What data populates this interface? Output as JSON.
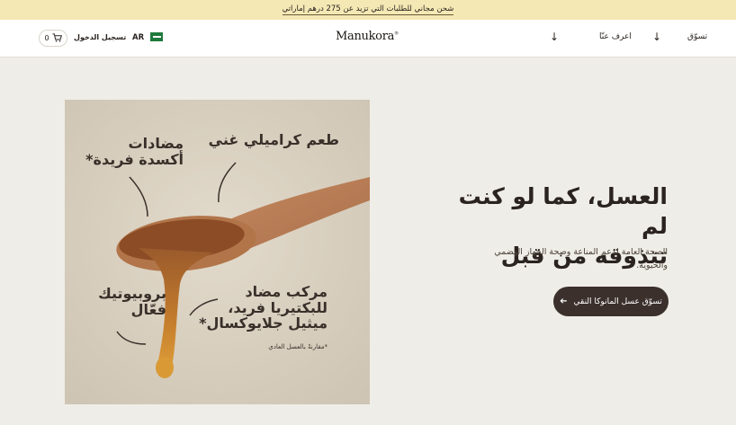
{
  "announcement": "شحن مجاني للطلبات التي تزيد عن 275 درهم إماراتي",
  "header": {
    "cart_count": "0",
    "login_label": "تسجيل الدخول",
    "language": "AR",
    "brand": "Manukora",
    "brand_mark": "®",
    "nav": {
      "shop_label": "تسوّق",
      "about_label": "اعرف عنّا"
    }
  },
  "image_panel": {
    "labels": {
      "caramel": "طعم كراميلي غني",
      "antioxidants_line1": "مضادات",
      "antioxidants_line2": "أكسدة فريدة*",
      "probiotic_line1": "بروبيوتيك",
      "probiotic_line2": "فعّال",
      "antibacterial_line1": "مركب مضاد",
      "antibacterial_line2": "للبكتيريا فريد،",
      "antibacterial_line3": "ميثيل جلايوكسال*",
      "footnote": "*مقارنةً بالعسل العادي"
    }
  },
  "hero": {
    "title_line1": "العسل، كما لو كنت لم",
    "title_line2": "تتذوقه من قبل",
    "subtitle": "الصحة العامة لدعم المناعة وصحة الجهاز الهضمي والحيوية.",
    "cta_label": "تسوّق عسل المانوكا النقي"
  },
  "icons": {
    "cart": "cart-icon",
    "flag": "uae-flag-icon",
    "dropdown": "arrow-down-icon",
    "cta_arrow": "arrow-left-icon"
  },
  "colors": {
    "announcement_bg": "#f4e8b4",
    "page_bg": "#efede7",
    "cta_bg": "#3b302c",
    "honey": "#c88a2c"
  }
}
